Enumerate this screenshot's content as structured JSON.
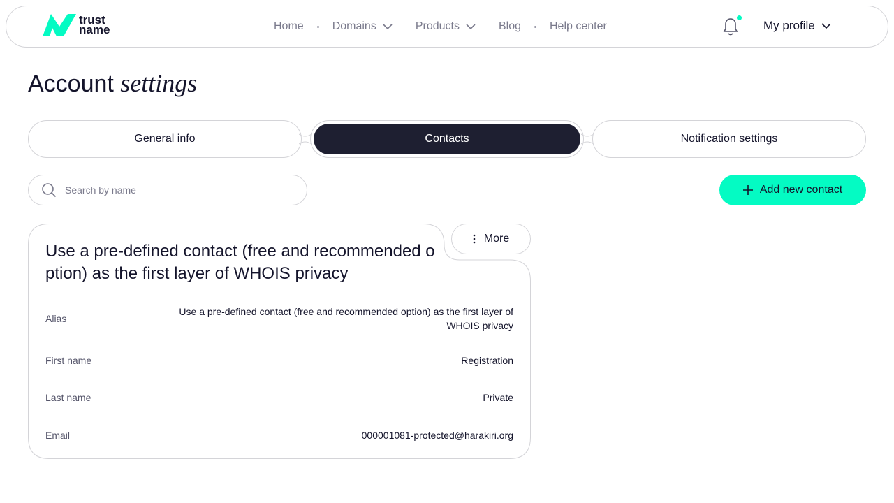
{
  "brand": {
    "line1": "trust",
    "line2": "name",
    "accent": "#04fbc3"
  },
  "nav": {
    "items": [
      {
        "label": "Home"
      },
      {
        "label": "Domains"
      },
      {
        "label": "Products"
      },
      {
        "label": "Blog"
      },
      {
        "label": "Help center"
      }
    ],
    "profile_label": "My profile"
  },
  "page": {
    "title_plain": "Account",
    "title_italic": "settings"
  },
  "tabs": [
    {
      "label": "General info",
      "active": false
    },
    {
      "label": "Contacts",
      "active": true
    },
    {
      "label": "Notification settings",
      "active": false
    }
  ],
  "search": {
    "placeholder": "Search by name",
    "value": ""
  },
  "add_button": {
    "label": "Add new contact"
  },
  "contact_card": {
    "title": "Use a pre-defined contact (free and recommended option) as the first layer of WHOIS privacy",
    "more_label": "More",
    "fields": [
      {
        "label": "Alias",
        "value": "Use a pre-defined contact (free and recommended option) as the first layer of WHOIS privacy"
      },
      {
        "label": "First name",
        "value": "Registration"
      },
      {
        "label": "Last name",
        "value": "Private"
      },
      {
        "label": "Email",
        "value": "000001081-protected@harakiri.org"
      }
    ]
  },
  "colors": {
    "accent": "#04fbc3",
    "dark": "#1e1f31",
    "border": "#d4d4d8",
    "muted": "#7a7a8c"
  }
}
